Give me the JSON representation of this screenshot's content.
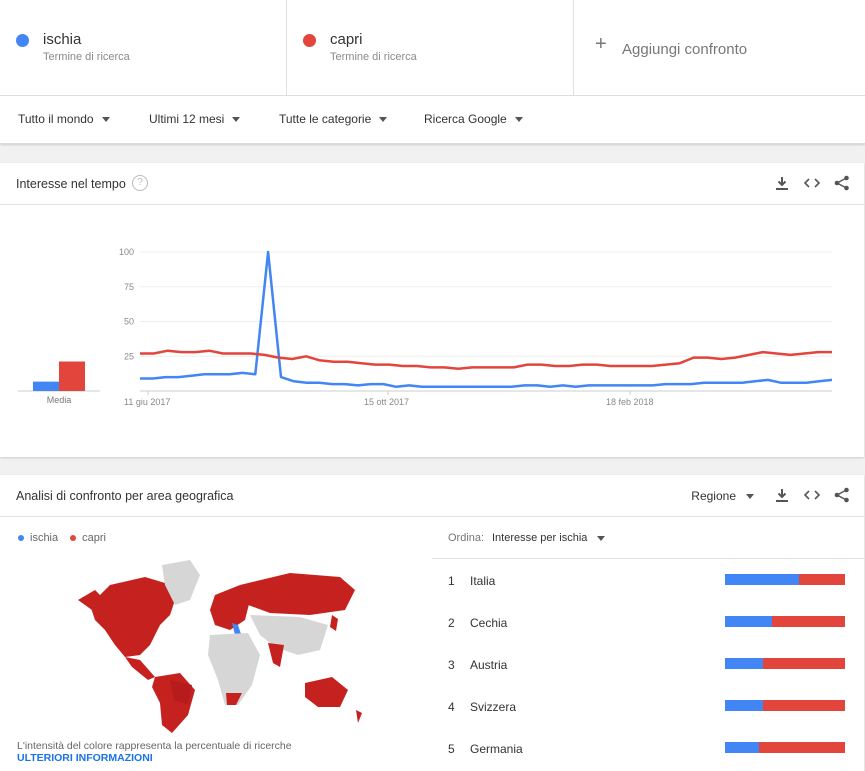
{
  "colors": {
    "ischia": "#4285f4",
    "capri": "#e2453c",
    "map_capri": "#c5221f",
    "map_ischia": "#4285f4",
    "map_none": "#d6d6d6"
  },
  "terms": [
    {
      "name": "ischia",
      "sub": "Termine di ricerca",
      "color": "#4285f4"
    },
    {
      "name": "capri",
      "sub": "Termine di ricerca",
      "color": "#e2453c"
    }
  ],
  "add_compare": {
    "icon": "plus-icon",
    "label": "Aggiungi confronto"
  },
  "filters": [
    "Tutto il mondo",
    "Ultimi 12 mesi",
    "Tutte le categorie",
    "Ricerca Google"
  ],
  "interest": {
    "title": "Interesse nel tempo",
    "help": "?",
    "avg_label": "Media",
    "avg": {
      "ischia": 7,
      "capri": 22
    },
    "chart_data": {
      "type": "line",
      "ylim": [
        0,
        100
      ],
      "yticks": [
        "100",
        "75",
        "50",
        "25"
      ],
      "xticks": [
        "11 giu 2017",
        "15 ott 2017",
        "18 feb 2018"
      ],
      "series": [
        {
          "name": "ischia",
          "values": [
            9,
            9,
            10,
            10,
            11,
            12,
            12,
            12,
            13,
            12,
            100,
            10,
            7,
            6,
            6,
            5,
            5,
            4,
            5,
            5,
            3,
            4,
            3,
            3,
            3,
            3,
            3,
            3,
            3,
            3,
            4,
            4,
            3,
            4,
            3,
            4,
            4,
            4,
            4,
            4,
            4,
            5,
            5,
            5,
            6,
            6,
            6,
            6,
            7,
            8,
            6,
            6,
            6,
            7,
            8
          ]
        },
        {
          "name": "capri",
          "values": [
            27,
            27,
            29,
            28,
            28,
            29,
            27,
            27,
            27,
            26,
            24,
            23,
            25,
            22,
            21,
            21,
            20,
            19,
            19,
            18,
            18,
            17,
            17,
            16,
            17,
            17,
            17,
            17,
            19,
            19,
            18,
            18,
            19,
            19,
            18,
            18,
            18,
            18,
            19,
            20,
            24,
            24,
            23,
            24,
            26,
            28,
            27,
            26,
            27,
            28,
            28
          ]
        }
      ]
    }
  },
  "geo": {
    "title": "Analisi di confronto per area geografica",
    "regione": "Regione",
    "legend": [
      "ischia",
      "capri"
    ],
    "note": "L'intensità del colore rappresenta la percentuale di ricerche",
    "more": "ULTERIORI INFORMAZIONI",
    "order_label": "Ordina:",
    "order_value": "Interesse per ischia",
    "ranking": [
      {
        "n": "1",
        "name": "Italia",
        "ischia": 0.62
      },
      {
        "n": "2",
        "name": "Cechia",
        "ischia": 0.39
      },
      {
        "n": "3",
        "name": "Austria",
        "ischia": 0.32
      },
      {
        "n": "4",
        "name": "Svizzera",
        "ischia": 0.32
      },
      {
        "n": "5",
        "name": "Germania",
        "ischia": 0.28
      }
    ]
  }
}
